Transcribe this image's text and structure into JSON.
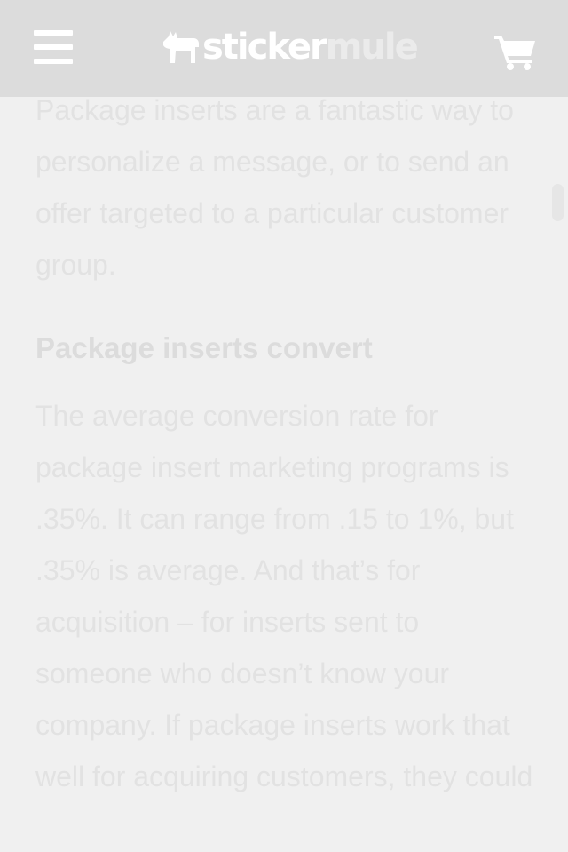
{
  "header": {
    "logo_part1": "sticker",
    "logo_part2": "mule",
    "icons": {
      "menu": "hamburger-menu-icon",
      "logo": "mule-logo-icon",
      "cart": "shopping-cart-icon"
    }
  },
  "article": {
    "intro_paragraph": "Package inserts are a fantastic way to personalize a message, or to send an offer targeted to a particular customer group.",
    "section_heading": "Package inserts convert",
    "section_paragraph": "The average conversion rate for package insert marketing programs is .35%. It can range from .15 to 1%, but .35% is average. And that’s for acquisition – for inserts sent to someone who doesn’t know your company. If package inserts work that well for acquiring customers, they could"
  },
  "colors": {
    "header_background": "#dcdcdc",
    "page_background": "#f0f0f0",
    "text": "#e2e2e2"
  }
}
